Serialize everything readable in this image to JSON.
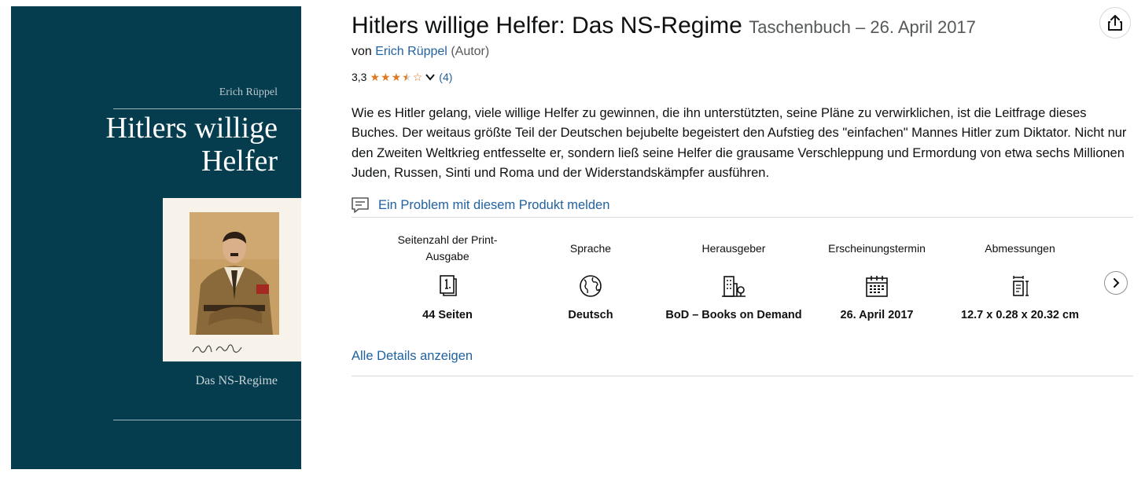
{
  "cover": {
    "author": "Erich Rüppel",
    "title_line1": "Hitlers willige",
    "title_line2": "Helfer",
    "subtitle": "Das NS-Regime"
  },
  "product": {
    "title": "Hitlers willige Helfer: Das NS-Regime",
    "format": "Taschenbuch – 26. April 2017",
    "by_prefix": "von",
    "author_name": "Erich Rüppel",
    "author_role": "(Autor)",
    "rating_value": "3,3",
    "rating_stars": 3.5,
    "rating_count": "(4)",
    "description": "Wie es Hitler gelang, viele willige Helfer zu gewinnen, die ihn unterstützten, seine Pläne zu verwirklichen, ist die Leitfrage dieses Buches. Der weitaus größte Teil der Deutschen bejubelte begeistert den Aufstieg des \"einfachen\" Mannes Hitler zum Diktator. Nicht nur den Zweiten Weltkrieg entfesselte er, sondern ließ seine Helfer die grausame Verschleppung und Ermordung von etwa sechs Millionen Juden, Russen, Sinti und Roma und der Widerstandskämpfer ausführen.",
    "report_label": "Ein Problem mit diesem Produkt melden"
  },
  "attributes": [
    {
      "label": "Seitenzahl der Print-Ausgabe",
      "value": "44 Seiten",
      "icon": "book-pages-icon"
    },
    {
      "label": "Sprache",
      "value": "Deutsch",
      "icon": "globe-icon"
    },
    {
      "label": "Herausgeber",
      "value": "BoD – Books on Demand",
      "icon": "building-icon"
    },
    {
      "label": "Erscheinungstermin",
      "value": "26. April 2017",
      "icon": "calendar-icon"
    },
    {
      "label": "Abmessungen",
      "value": "12.7 x 0.28 x 20.32 cm",
      "icon": "dimensions-icon"
    }
  ],
  "details_link": "Alle Details anzeigen",
  "colors": {
    "link": "#2162a1",
    "star": "#de7921",
    "cover_bg": "#053d4f"
  }
}
